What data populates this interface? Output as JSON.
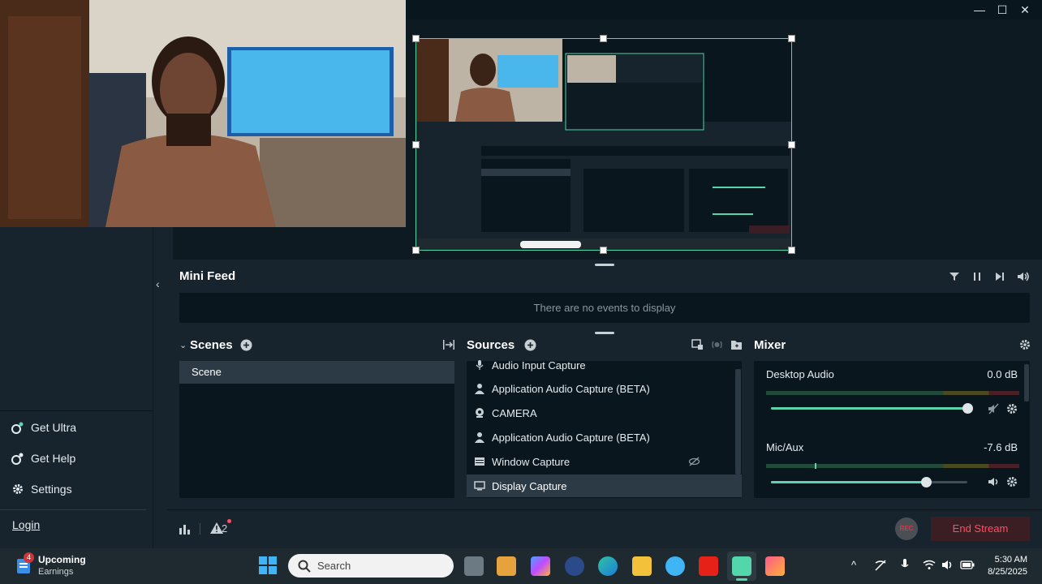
{
  "window": {
    "minimize": "—",
    "maximize": "☐",
    "close": "✕"
  },
  "nav": {
    "items": [
      {
        "label": "Get Ultra",
        "icon": "ultra-icon"
      },
      {
        "label": "Get Help",
        "icon": "help-icon"
      },
      {
        "label": "Settings",
        "icon": "gear-icon"
      }
    ],
    "login": "Login"
  },
  "minifeed": {
    "title": "Mini Feed",
    "empty": "There are no events to display"
  },
  "scenes": {
    "title": "Scenes",
    "items": [
      "Scene"
    ]
  },
  "sources": {
    "title": "Sources",
    "items": [
      {
        "label": "Audio Input Capture",
        "icon": "microphone-icon"
      },
      {
        "label": "Application Audio Capture (BETA)",
        "icon": "person-icon"
      },
      {
        "label": "CAMERA",
        "icon": "webcam-icon"
      },
      {
        "label": "Application Audio Capture (BETA)",
        "icon": "person-icon"
      },
      {
        "label": "Window Capture",
        "icon": "window-icon"
      },
      {
        "label": "Display Capture",
        "icon": "monitor-icon"
      }
    ]
  },
  "mixer": {
    "title": "Mixer",
    "channels": [
      {
        "name": "Desktop Audio",
        "value": "0.0 dB",
        "level": 1.0
      },
      {
        "name": "Mic/Aux",
        "value": "-7.6 dB",
        "level": 0.79
      }
    ]
  },
  "bottombar": {
    "alerts": "2",
    "rec": "REC",
    "end_stream": "End Stream"
  },
  "taskbar": {
    "weather_badge": "4",
    "weather_title": "Upcoming",
    "weather_sub": "Earnings",
    "search": "Search",
    "time": "5:30 AM",
    "date": "8/25/2025"
  },
  "colors": {
    "accent": "#53d6a9",
    "end_stream": "#ff4e61",
    "panel": "#09161d",
    "chrome": "#17242d"
  }
}
